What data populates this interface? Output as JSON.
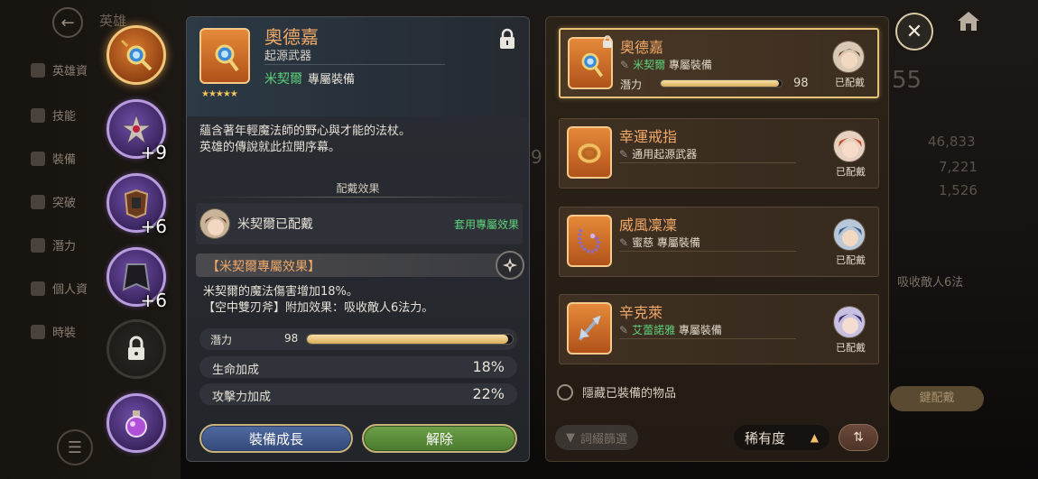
{
  "background": {
    "header_label": "英雄",
    "side_menu": [
      "英雄資",
      "技能",
      "裝備",
      "突破",
      "潛力",
      "個人資",
      "時裝"
    ],
    "stats": [
      "46,833",
      "7,221",
      "1,526"
    ],
    "big_number": "55",
    "snippet": "吸收敵人6法",
    "confirm_hint": "鍵配戴",
    "partial_nine": "9"
  },
  "slots": [
    {
      "name": "weapon",
      "style": "orange",
      "plus": ""
    },
    {
      "name": "ring",
      "style": "purple",
      "plus": "+9"
    },
    {
      "name": "armor",
      "style": "purple",
      "plus": "+6"
    },
    {
      "name": "cloak",
      "style": "purple",
      "plus": "+6"
    },
    {
      "name": "locked",
      "style": "dark",
      "plus": ""
    },
    {
      "name": "potion",
      "style": "purple",
      "plus": ""
    }
  ],
  "detail": {
    "name": "奧德嘉",
    "type": "起源武器",
    "hero": "米契爾",
    "tag": "專屬裝備",
    "stars": "★★★★★",
    "description": [
      "蘊含著年輕魔法師的野心與才能的法杖。",
      "英雄的傳說就此拉開序幕。"
    ],
    "section_title": "配戴效果",
    "owner_text": "米契爾已配戴",
    "apply_label": "套用專屬效果",
    "exclusive_title": "【米契爾專屬效果】",
    "effects": [
      "米契爾的魔法傷害增加18%。",
      "【空中雙刃斧】附加效果：吸收敵人6法力。"
    ],
    "potential_label": "潛力",
    "potential_value": "98",
    "potential_fraction": 0.98,
    "stats": [
      {
        "label": "生命加成",
        "value": "18%"
      },
      {
        "label": "攻擊力加成",
        "value": "22%"
      }
    ],
    "grow_button": "裝備成長",
    "unequip_button": "解除"
  },
  "list": {
    "items": [
      {
        "name": "奧德嘉",
        "hero": "米契爾",
        "tag": "專屬裝備",
        "potential_label": "潛力",
        "potential_value": "98",
        "potential_fraction": 0.98,
        "equipped": "已配戴",
        "selected": true,
        "locked": true
      },
      {
        "name": "幸運戒指",
        "hero": "",
        "tag": "通用起源武器",
        "equipped": "已配戴",
        "selected": false
      },
      {
        "name": "威風凜凜",
        "hero": "",
        "tag": "蜜慈 專屬裝備",
        "equipped": "已配戴",
        "selected": false
      },
      {
        "name": "辛克萊",
        "hero": "艾蕾諾雅",
        "tag": "專屬裝備",
        "equipped": "已配戴",
        "selected": false
      }
    ],
    "hide_equipped_label": "隱藏已裝備的物品",
    "filter_label": "詞綴篩選",
    "sort_label": "稀有度",
    "sort_arrow": "▲",
    "colors": {
      "item_name": "#f0a868",
      "hero_name": "#5fd07a",
      "selected_border": "#e6c27a"
    }
  },
  "icons": {
    "close": "✕",
    "back": "←",
    "menu": "☰"
  }
}
